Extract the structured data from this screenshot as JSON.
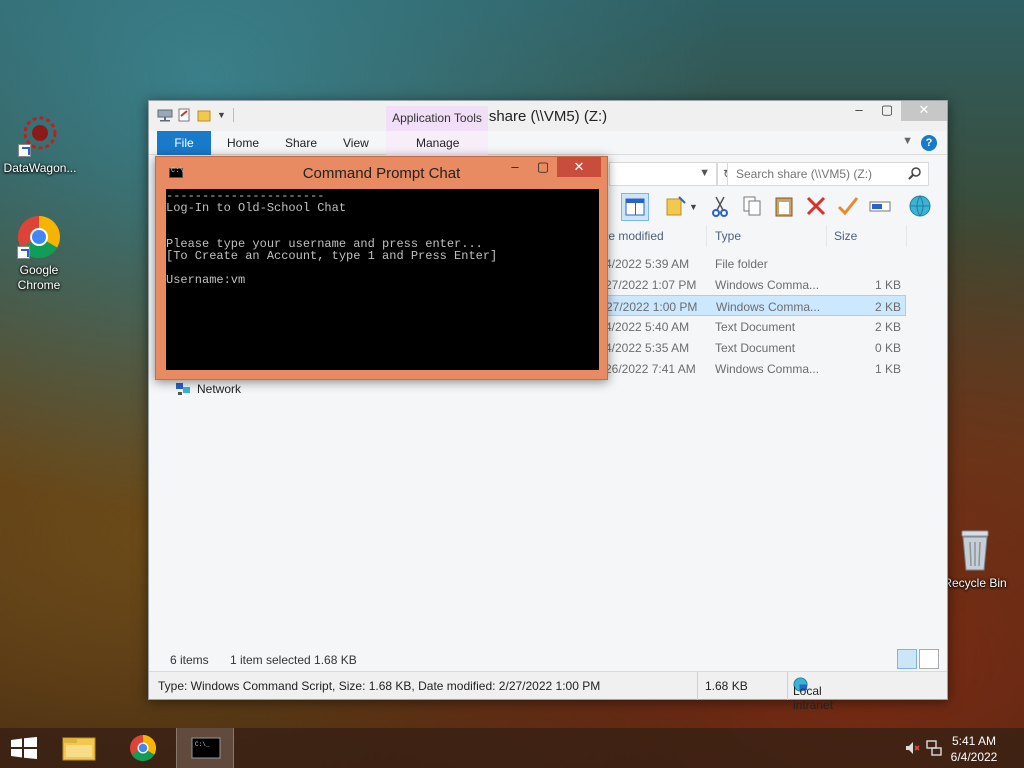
{
  "desktop": {
    "icons": [
      {
        "label": "DataWagon..."
      },
      {
        "label": "Google Chrome"
      },
      {
        "label": "Recycle Bin"
      }
    ]
  },
  "explorer": {
    "title": "share (\\\\VM5) (Z:)",
    "context_tab": "Application Tools",
    "tabs": [
      "File",
      "Home",
      "Share",
      "View",
      "Manage"
    ],
    "search_placeholder": "Search share (\\\\VM5) (Z:)",
    "columns": {
      "date": "te modified",
      "type": "Type",
      "size": "Size"
    },
    "rows": [
      {
        "date": "4/2022 5:39 AM",
        "type": "File folder",
        "size": ""
      },
      {
        "date": "27/2022 1:07 PM",
        "type": "Windows Comma...",
        "size": "1 KB"
      },
      {
        "date": "27/2022 1:00 PM",
        "type": "Windows Comma...",
        "size": "2 KB",
        "selected": true
      },
      {
        "date": "4/2022 5:40 AM",
        "type": "Text Document",
        "size": "2 KB"
      },
      {
        "date": "4/2022 5:35 AM",
        "type": "Text Document",
        "size": "0 KB"
      },
      {
        "date": "26/2022 7:41 AM",
        "type": "Windows Comma...",
        "size": "1 KB"
      }
    ],
    "nav_network": "Network",
    "status_items": "6 items",
    "status_selected": "1 item selected  1.68 KB",
    "details_text": "Type: Windows Command Script, Size: 1.68 KB, Date modified: 2/27/2022 1:00 PM",
    "details_size": "1.68 KB",
    "details_zone": "Local intranet"
  },
  "cmd": {
    "title": "Command Prompt Chat",
    "lines": [
      "----------------------",
      "Log-In to Old-School Chat",
      "",
      "",
      "Please type your username and press enter...",
      "[To Create an Account, type 1 and Press Enter]",
      "",
      "Username:vm"
    ]
  },
  "taskbar": {
    "time": "5:41 AM",
    "date": "6/4/2022"
  },
  "colors": {
    "file_tab": "#1979ca",
    "cmd_frame": "#e98b62",
    "cmd_close": "#c84d3c",
    "selection": "#cce8ff",
    "app_tools": "#f1def7"
  }
}
